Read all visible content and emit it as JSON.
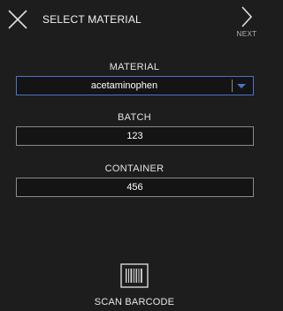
{
  "header": {
    "title": "SELECT MATERIAL",
    "next_label": "NEXT"
  },
  "fields": {
    "material": {
      "label": "MATERIAL",
      "value": "acetaminophen"
    },
    "batch": {
      "label": "BATCH",
      "value": "123"
    },
    "container": {
      "label": "CONTAINER",
      "value": "456"
    }
  },
  "scan": {
    "label": "SCAN BARCODE"
  },
  "colors": {
    "background": "#1d1d1d",
    "field_background": "#141414",
    "field_border": "#8a8a8a",
    "select_border": "#4d74c6",
    "select_arrow": "#4d74c6"
  },
  "icons": [
    "close-icon",
    "chevron-right-icon",
    "dropdown-arrow-icon",
    "barcode-icon"
  ]
}
